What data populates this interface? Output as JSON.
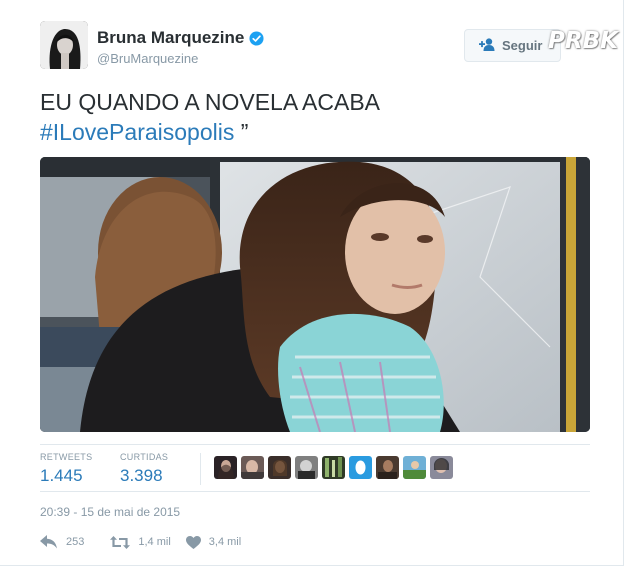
{
  "user": {
    "name": "Bruna Marquezine",
    "handle": "@BruMarquezine"
  },
  "follow_button": {
    "label": "Seguir"
  },
  "watermark": "PRBK",
  "tweet": {
    "text_line1": "EU QUANDO A NOVELA ACABA",
    "hashtag": "#ILoveParaisopolis",
    "text_tail": " ”"
  },
  "stats": {
    "retweets_label": "RETWEETS",
    "retweets_value": "1.445",
    "likes_label": "CURTIDAS",
    "likes_value": "3.398"
  },
  "timestamp": "20:39 - 15 de mai de 2015",
  "actions": {
    "reply_count": "253",
    "retweet_count": "1,4 mil",
    "like_count": "3,4 mil"
  },
  "colors": {
    "link_blue": "#2b7bb9",
    "verified_blue": "#1da1f2",
    "muted_gray": "#8899a6"
  }
}
